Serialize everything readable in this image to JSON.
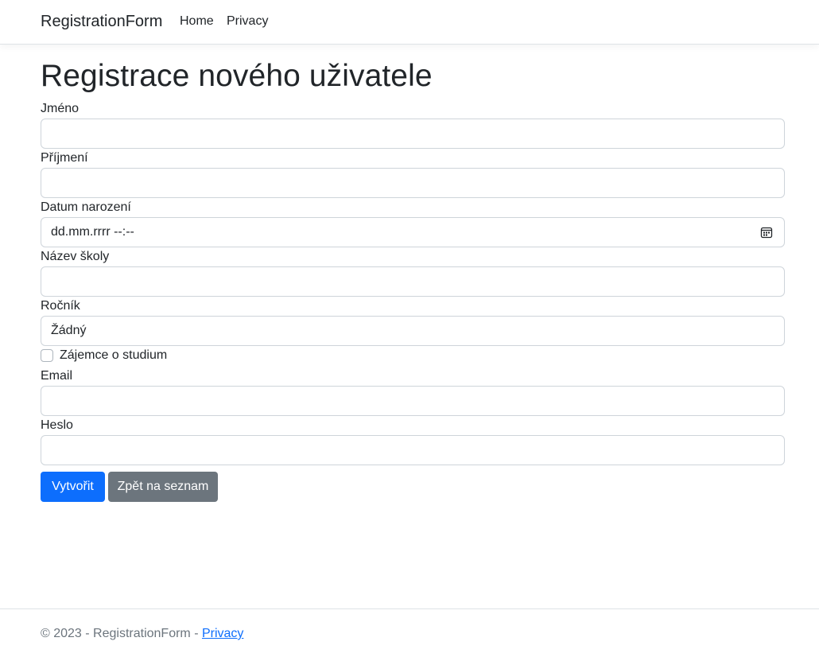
{
  "navbar": {
    "brand": "RegistrationForm",
    "links": [
      "Home",
      "Privacy"
    ]
  },
  "page_title": "Registrace nového uživatele",
  "form": {
    "first_name": {
      "label": "Jméno",
      "value": ""
    },
    "last_name": {
      "label": "Příjmení",
      "value": ""
    },
    "birth_date": {
      "label": "Datum narození",
      "placeholder": "dd.mm.rrrr --:--"
    },
    "school": {
      "label": "Název školy",
      "value": ""
    },
    "grade": {
      "label": "Ročník",
      "selected": "Žádný"
    },
    "interested": {
      "label": "Zájemce o studium",
      "checked": false
    },
    "email": {
      "label": "Email",
      "value": ""
    },
    "password": {
      "label": "Heslo",
      "value": ""
    }
  },
  "buttons": {
    "create": "Vytvořit",
    "back": "Zpět na seznam"
  },
  "footer": {
    "text": "© 2023 - RegistrationForm - ",
    "link": "Privacy"
  },
  "colors": {
    "primary": "#0d6efd",
    "secondary": "#6c757d",
    "border": "#ced4da"
  }
}
